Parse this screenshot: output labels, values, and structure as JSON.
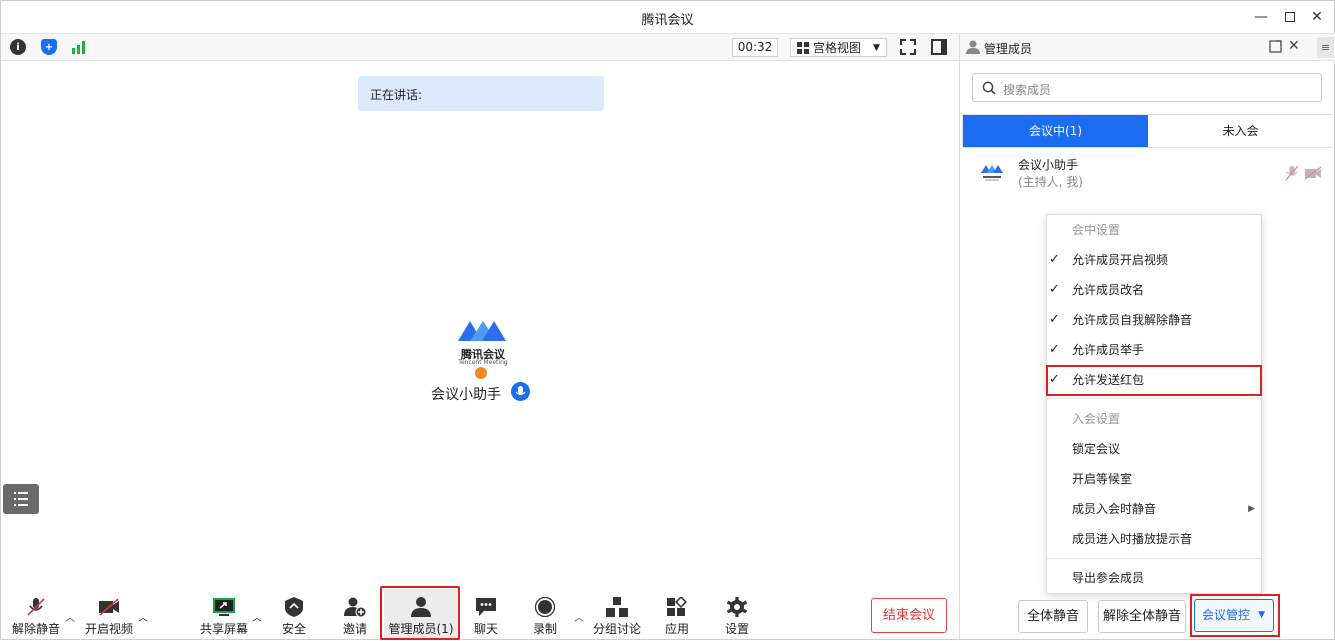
{
  "window": {
    "title": "腾讯会议"
  },
  "toolbar": {
    "timer": "00:32",
    "view_label": "宫格视图"
  },
  "speaking": {
    "label": "正在讲话:"
  },
  "stage": {
    "logo_text": "腾讯会议",
    "logo_sub": "Tencent Meeting",
    "host_name": "会议小助手"
  },
  "bottom": {
    "unmute": "解除静音",
    "video": "开启视频",
    "share": "共享屏幕",
    "security": "安全",
    "invite": "邀请",
    "members": "管理成员(1)",
    "chat": "聊天",
    "record": "录制",
    "breakout": "分组讨论",
    "apps": "应用",
    "settings": "设置",
    "end": "结束会议"
  },
  "panel": {
    "title": "管理成员",
    "search_placeholder": "搜索成员",
    "tabs": [
      "会议中(1)",
      "未入会"
    ],
    "member": {
      "name": "会议小助手",
      "role": "(主持人, 我)"
    }
  },
  "menu": {
    "section1": "会中设置",
    "items1": [
      "允许成员开启视频",
      "允许成员改名",
      "允许成员自我解除静音",
      "允许成员举手",
      "允许发送红包"
    ],
    "section2": "入会设置",
    "items2": [
      "锁定会议",
      "开启等候室",
      "成员入会时静音",
      "成员进入时播放提示音"
    ],
    "export": "导出参会成员"
  },
  "panel_buttons": {
    "mute_all": "全体静音",
    "unmute_all": "解除全体静音",
    "control": "会议管控"
  },
  "colors": {
    "accent": "#1b6ef3",
    "danger": "#e03535",
    "highlight": "#e02020"
  }
}
